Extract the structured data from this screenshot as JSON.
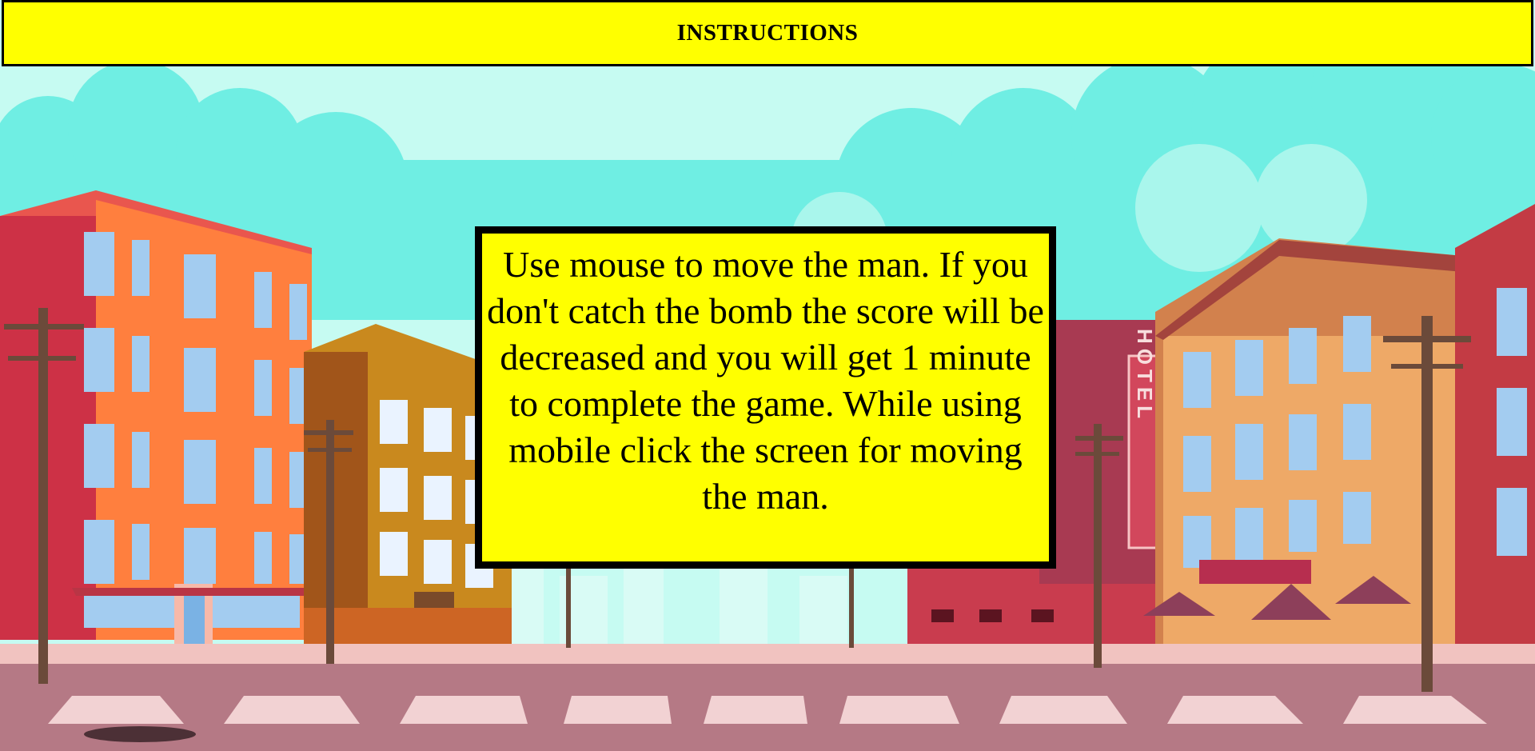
{
  "header": {
    "title": "INSTRUCTIONS"
  },
  "instructions": {
    "text": "Use mouse to move the man. If you don't catch the bomb the score will be decreased and you will get 1 minute to complete the game. While using mobile click the screen for moving the man."
  },
  "scene": {
    "hotel_sign": "HOTEL"
  },
  "colors": {
    "panel_background": "#ffff00",
    "panel_border": "#000000",
    "sky": "#c6fbf2",
    "clouds": "#6feee3",
    "road": "#b57985"
  }
}
